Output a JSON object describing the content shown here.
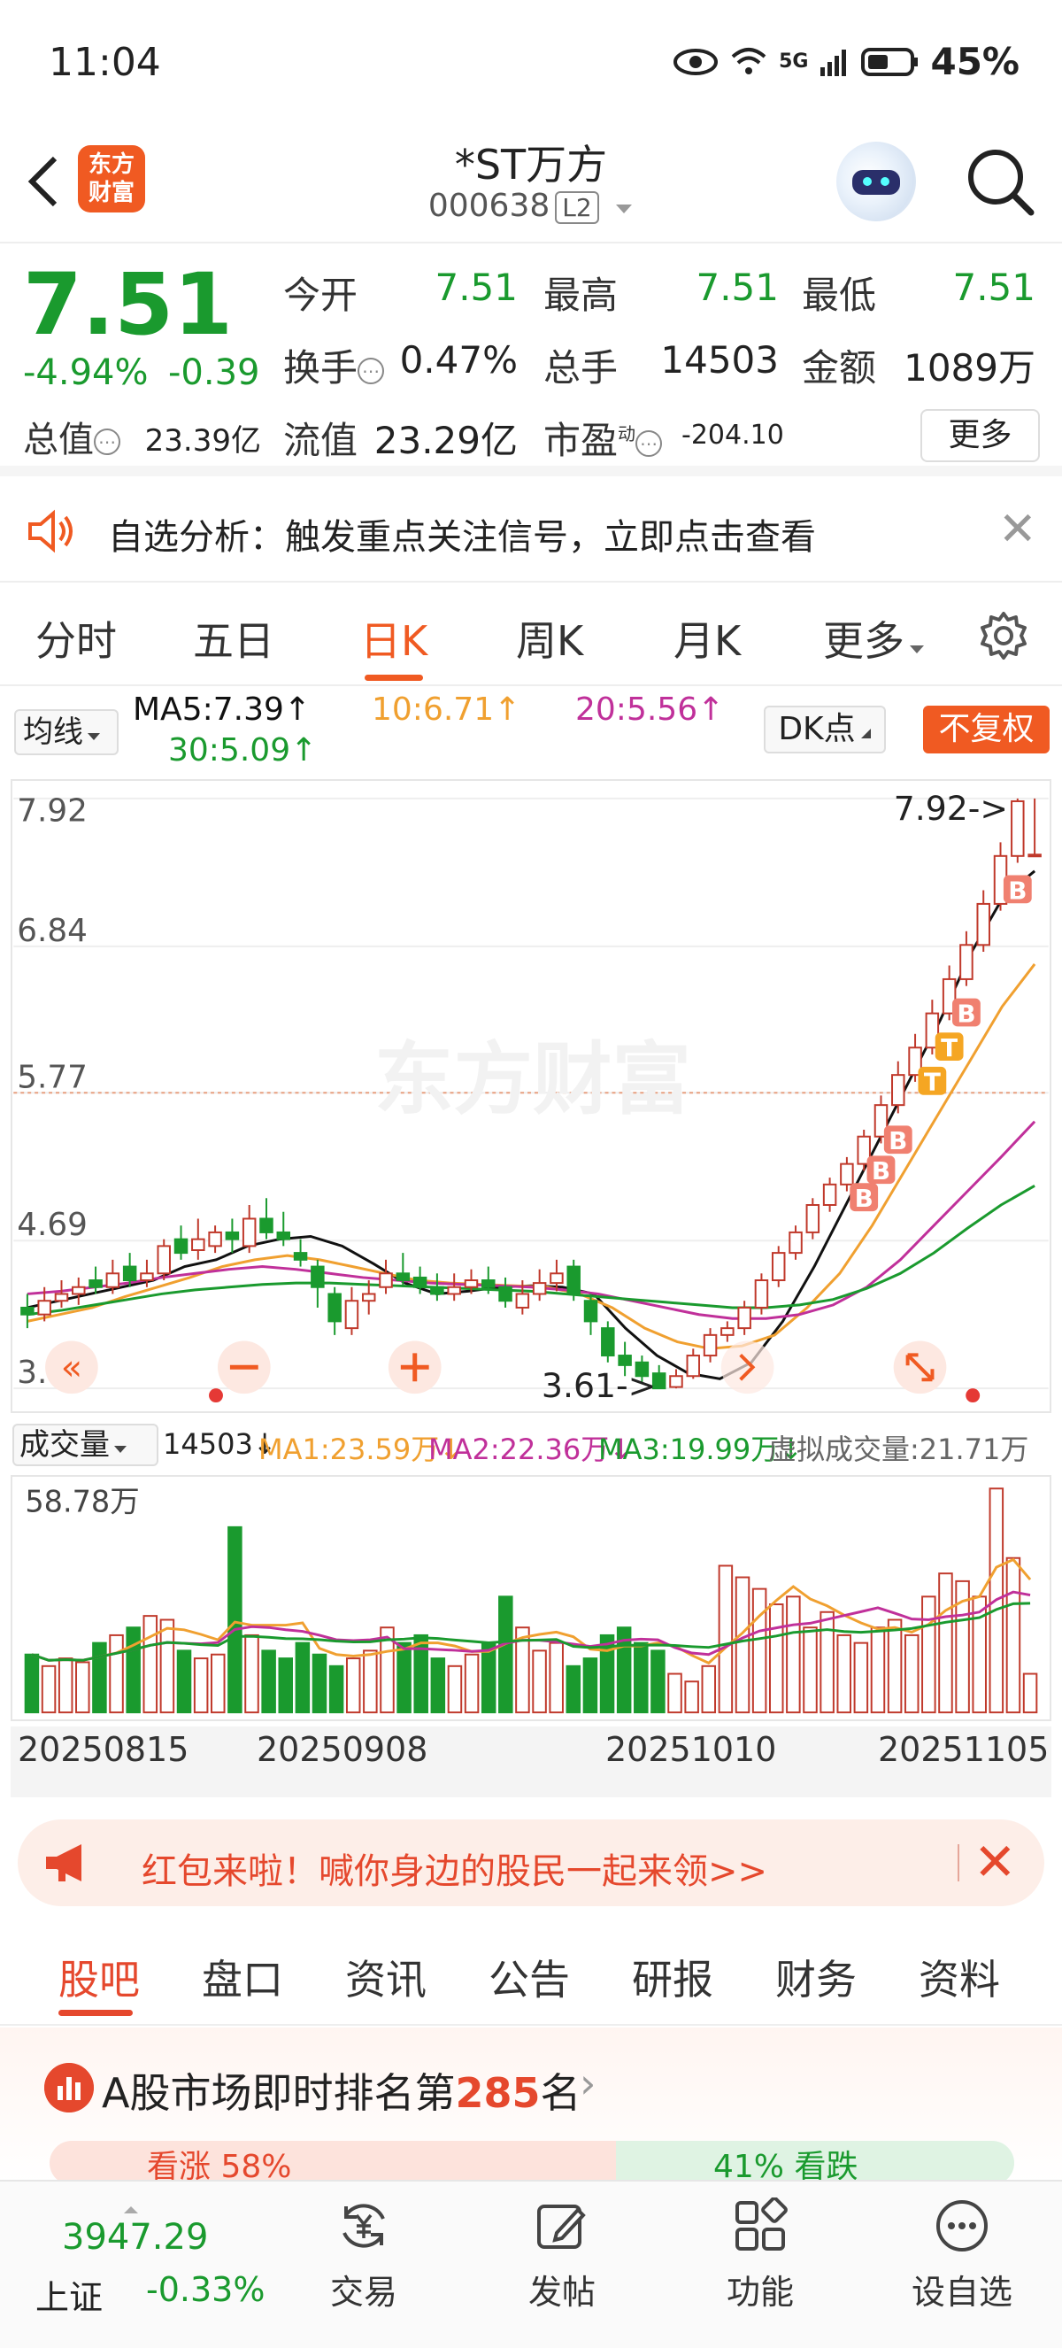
{
  "status": {
    "time": "11:04",
    "network": "5G",
    "battery": "45%"
  },
  "header": {
    "logo_top": "东方",
    "logo_bottom": "财富",
    "stock_name": "*ST万方",
    "stock_code": "000638",
    "level": "L2"
  },
  "quote": {
    "price": "7.51",
    "change_pct": "-4.94%",
    "change": "-0.39",
    "open_label": "今开",
    "open": "7.51",
    "high_label": "最高",
    "high": "7.51",
    "low_label": "最低",
    "low": "7.51",
    "turnover_label": "换手",
    "turnover": "0.47%",
    "volume_label": "总手",
    "volume": "14503",
    "amount_label": "金额",
    "amount": "1089万",
    "mktcap_label": "总值",
    "mktcap": "23.39亿",
    "float_label": "流值",
    "float_cap": "23.29亿",
    "pe_label": "市盈",
    "pe_sup": "动",
    "pe": "-204.10",
    "more_label": "更多"
  },
  "alert": {
    "text": "自选分析：触发重点关注信号，立即点击查看"
  },
  "chart_tabs": [
    "分时",
    "五日",
    "日K",
    "周K",
    "月K",
    "更多"
  ],
  "chart_tabs_active": "日K",
  "ma_row": {
    "avg_label": "均线",
    "ma5": "MA5:7.39↑",
    "ma10": "10:6.71↑",
    "ma20": "20:5.56↑",
    "ma30": "30:5.09↑",
    "dk_label": "DK点",
    "adjust_label": "不复权"
  },
  "colors": {
    "up": "#c0392b",
    "down": "#1a9a2e",
    "ma5": "#111111",
    "ma10": "#f0a030",
    "ma20": "#c0309a",
    "ma30": "#1a9a2e",
    "accent": "#f05a22"
  },
  "chart_data": {
    "type": "candlestick",
    "y_ticks": [
      "7.92",
      "6.84",
      "5.77",
      "4.69",
      "3.61"
    ],
    "ylim": [
      3.61,
      7.92
    ],
    "last_close_line": 5.77,
    "max_label": "7.92->",
    "min_label": "3.61->",
    "watermark": "东方财富",
    "candles": [
      [
        4.2,
        4.15,
        4.3,
        4.05
      ],
      [
        4.15,
        4.25,
        4.35,
        4.1
      ],
      [
        4.25,
        4.3,
        4.4,
        4.2
      ],
      [
        4.3,
        4.35,
        4.42,
        4.22
      ],
      [
        4.4,
        4.35,
        4.5,
        4.3
      ],
      [
        4.35,
        4.45,
        4.55,
        4.3
      ],
      [
        4.5,
        4.4,
        4.6,
        4.35
      ],
      [
        4.4,
        4.45,
        4.55,
        4.35
      ],
      [
        4.45,
        4.65,
        4.7,
        4.4
      ],
      [
        4.7,
        4.6,
        4.8,
        4.55
      ],
      [
        4.62,
        4.7,
        4.85,
        4.55
      ],
      [
        4.65,
        4.75,
        4.8,
        4.6
      ],
      [
        4.75,
        4.7,
        4.85,
        4.6
      ],
      [
        4.65,
        4.85,
        4.95,
        4.6
      ],
      [
        4.85,
        4.75,
        5.0,
        4.7
      ],
      [
        4.75,
        4.7,
        4.9,
        4.65
      ],
      [
        4.6,
        4.55,
        4.7,
        4.5
      ],
      [
        4.5,
        4.35,
        4.55,
        4.2
      ],
      [
        4.3,
        4.1,
        4.35,
        4.0
      ],
      [
        4.05,
        4.25,
        4.35,
        4.0
      ],
      [
        4.25,
        4.3,
        4.4,
        4.15
      ],
      [
        4.35,
        4.45,
        4.55,
        4.3
      ],
      [
        4.45,
        4.4,
        4.6,
        4.35
      ],
      [
        4.42,
        4.35,
        4.5,
        4.3
      ],
      [
        4.35,
        4.3,
        4.45,
        4.25
      ],
      [
        4.3,
        4.35,
        4.45,
        4.25
      ],
      [
        4.35,
        4.4,
        4.48,
        4.3
      ],
      [
        4.4,
        4.35,
        4.5,
        4.3
      ],
      [
        4.35,
        4.25,
        4.42,
        4.2
      ],
      [
        4.2,
        4.3,
        4.4,
        4.15
      ],
      [
        4.3,
        4.38,
        4.48,
        4.25
      ],
      [
        4.38,
        4.45,
        4.55,
        4.32
      ],
      [
        4.5,
        4.3,
        4.55,
        4.25
      ],
      [
        4.25,
        4.1,
        4.3,
        4.0
      ],
      [
        4.05,
        3.85,
        4.1,
        3.8
      ],
      [
        3.85,
        3.78,
        3.95,
        3.7
      ],
      [
        3.8,
        3.7,
        3.85,
        3.65
      ],
      [
        3.72,
        3.61,
        3.78,
        3.61
      ],
      [
        3.62,
        3.7,
        3.75,
        3.61
      ],
      [
        3.7,
        3.85,
        3.9,
        3.68
      ],
      [
        3.85,
        4.0,
        4.05,
        3.8
      ],
      [
        4.0,
        4.05,
        4.1,
        3.95
      ],
      [
        4.05,
        4.2,
        4.25,
        4.0
      ],
      [
        4.2,
        4.4,
        4.45,
        4.15
      ],
      [
        4.4,
        4.6,
        4.65,
        4.35
      ],
      [
        4.6,
        4.75,
        4.8,
        4.55
      ],
      [
        4.75,
        4.95,
        5.0,
        4.7
      ],
      [
        4.95,
        5.1,
        5.15,
        4.9
      ],
      [
        5.1,
        5.25,
        5.3,
        5.05
      ],
      [
        5.25,
        5.45,
        5.5,
        5.2
      ],
      [
        5.45,
        5.68,
        5.75,
        5.4
      ],
      [
        5.68,
        5.9,
        6.0,
        5.62
      ],
      [
        5.9,
        6.1,
        6.2,
        5.85
      ],
      [
        6.1,
        6.35,
        6.45,
        6.05
      ],
      [
        6.35,
        6.6,
        6.7,
        6.3
      ],
      [
        6.6,
        6.85,
        6.95,
        6.55
      ],
      [
        6.85,
        7.15,
        7.25,
        6.8
      ],
      [
        7.15,
        7.5,
        7.6,
        7.1
      ],
      [
        7.5,
        7.9,
        7.92,
        7.45
      ],
      [
        7.51,
        7.51,
        7.92,
        7.51
      ]
    ],
    "ma_lines": {
      "MA5": [
        4.2,
        4.25,
        4.3,
        4.35,
        4.4,
        4.5,
        4.55,
        4.65,
        4.7,
        4.72,
        4.65,
        4.52,
        4.38,
        4.3,
        4.32,
        4.35,
        4.36,
        4.35,
        4.3,
        4.05,
        3.85,
        3.72,
        3.68,
        3.8,
        4.1,
        4.5,
        4.95,
        5.4,
        5.85,
        6.3,
        6.8,
        7.2,
        7.39
      ],
      "MA10": [
        4.1,
        4.15,
        4.2,
        4.28,
        4.35,
        4.42,
        4.5,
        4.55,
        4.58,
        4.55,
        4.5,
        4.45,
        4.4,
        4.38,
        4.37,
        4.36,
        4.35,
        4.3,
        4.2,
        4.05,
        3.95,
        3.9,
        3.92,
        4.0,
        4.2,
        4.45,
        4.8,
        5.2,
        5.6,
        6.0,
        6.4,
        6.71
      ],
      "MA20": [
        4.3,
        4.32,
        4.35,
        4.38,
        4.42,
        4.45,
        4.48,
        4.5,
        4.48,
        4.45,
        4.42,
        4.4,
        4.38,
        4.37,
        4.36,
        4.35,
        4.33,
        4.3,
        4.25,
        4.2,
        4.15,
        4.12,
        4.12,
        4.15,
        4.22,
        4.35,
        4.55,
        4.8,
        5.05,
        5.3,
        5.56
      ],
      "MA30": [
        4.15,
        4.18,
        4.22,
        4.26,
        4.3,
        4.33,
        4.35,
        4.37,
        4.38,
        4.38,
        4.37,
        4.36,
        4.35,
        4.34,
        4.33,
        4.32,
        4.3,
        4.28,
        4.26,
        4.24,
        4.22,
        4.2,
        4.2,
        4.22,
        4.26,
        4.34,
        4.45,
        4.6,
        4.78,
        4.95,
        5.09
      ]
    },
    "signals": [
      "B",
      "B",
      "B",
      "T",
      "T",
      "B",
      "B"
    ]
  },
  "volume": {
    "label": "成交量",
    "current": "14503↓",
    "ma1": "MA1:23.59万↓",
    "ma2": "MA2:22.36万↓",
    "ma3": "MA3:19.99万↓",
    "virtual": "虚拟成交量:21.71万",
    "max_label": "58.78万",
    "bars": [
      15,
      12,
      14,
      13,
      18,
      20,
      22,
      25,
      24,
      16,
      14,
      15,
      48,
      20,
      16,
      14,
      18,
      15,
      12,
      14,
      16,
      22,
      18,
      20,
      14,
      12,
      15,
      18,
      30,
      22,
      16,
      18,
      12,
      14,
      20,
      22,
      18,
      16,
      10,
      8,
      12,
      38,
      35,
      32,
      28,
      30,
      22,
      26,
      20,
      18,
      22,
      24,
      20,
      30,
      36,
      34,
      30,
      58,
      40,
      10
    ]
  },
  "dates": [
    "20250815",
    "20250908",
    "20251010",
    "20251105"
  ],
  "promo": {
    "text": "红包来啦！喊你身边的股民一起来领>>"
  },
  "section_tabs": [
    "股吧",
    "盘口",
    "资讯",
    "公告",
    "研报",
    "财务",
    "资料"
  ],
  "rank": {
    "prefix": "A股市场即时排名第",
    "number": "285",
    "suffix": "名",
    "up_label": "看涨 58%",
    "down_label": "41% 看跌"
  },
  "bottom": {
    "index_value": "3947.29",
    "index_name": "上证",
    "index_pct": "-0.33%",
    "nav": [
      "交易",
      "发帖",
      "功能",
      "设自选"
    ]
  }
}
